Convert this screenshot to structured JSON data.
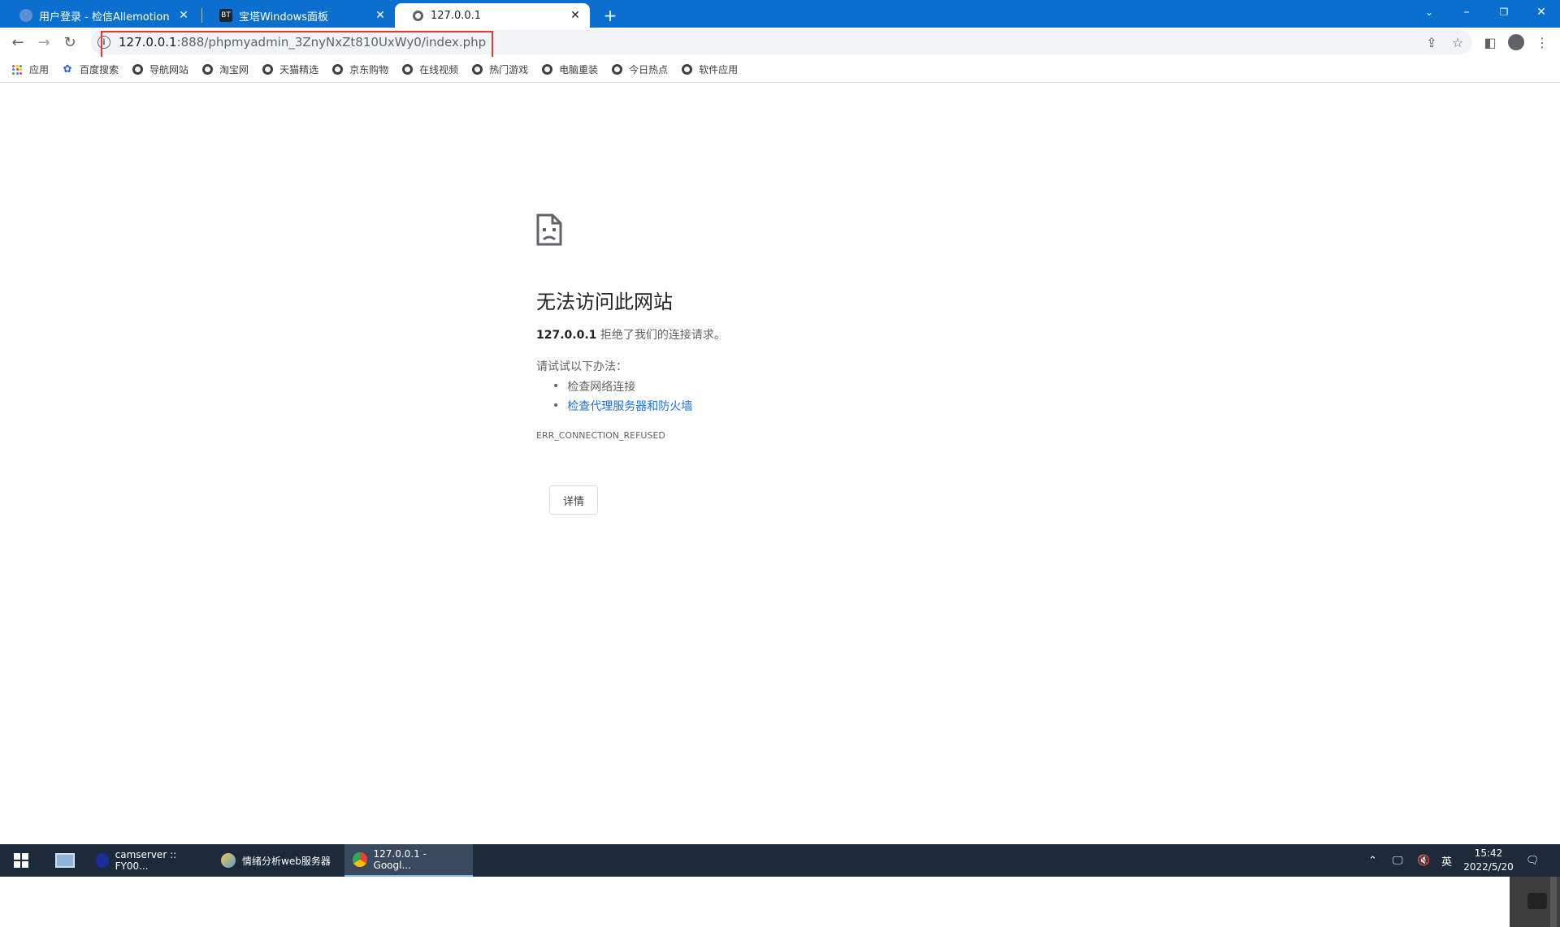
{
  "tabs": [
    {
      "title": "用户登录 - 检信Allemotion 多维",
      "favicon": "globe-icon"
    },
    {
      "title": "宝塔Windows面板",
      "favicon": "BT"
    },
    {
      "title": "127.0.0.1",
      "favicon": "globe-icon"
    }
  ],
  "omnibox": {
    "url_host": "127.0.0.1",
    "url_rest": ":888/phpmyadmin_3ZnyNxZt810UxWy0/index.php"
  },
  "bookmarks": [
    {
      "label": "应用",
      "icon": "apps-grid-icon"
    },
    {
      "label": "百度搜索",
      "icon": "baidu-paw-icon"
    },
    {
      "label": "导航网站",
      "icon": "globe-icon"
    },
    {
      "label": "淘宝网",
      "icon": "globe-icon"
    },
    {
      "label": "天猫精选",
      "icon": "globe-icon"
    },
    {
      "label": "京东购物",
      "icon": "globe-icon"
    },
    {
      "label": "在线视频",
      "icon": "globe-icon"
    },
    {
      "label": "热门游戏",
      "icon": "globe-icon"
    },
    {
      "label": "电脑重装",
      "icon": "globe-icon"
    },
    {
      "label": "今日热点",
      "icon": "globe-icon"
    },
    {
      "label": "软件应用",
      "icon": "globe-icon"
    }
  ],
  "error": {
    "title": "无法访问此网站",
    "host": "127.0.0.1",
    "desc": " 拒绝了我们的连接请求。",
    "try_label": "请试试以下办法：",
    "suggestions": [
      "检查网络连接",
      "检查代理服务器和防火墙"
    ],
    "code": "ERR_CONNECTION_REFUSED",
    "details_label": "详情"
  },
  "taskbar": {
    "items": [
      {
        "label": "camserver :: FY00...",
        "icon": "database-icon"
      },
      {
        "label": "情绪分析web服务器",
        "icon": "server-icon"
      },
      {
        "label": "127.0.0.1 - Googl...",
        "icon": "chrome-icon"
      }
    ],
    "ime": "英",
    "time": "15:42",
    "date": "2022/5/20"
  },
  "colors": {
    "tabstrip": "#0b6fd0",
    "link": "#1a73e8",
    "highlight": "#e53935",
    "taskbar": "#1d2a3b"
  }
}
